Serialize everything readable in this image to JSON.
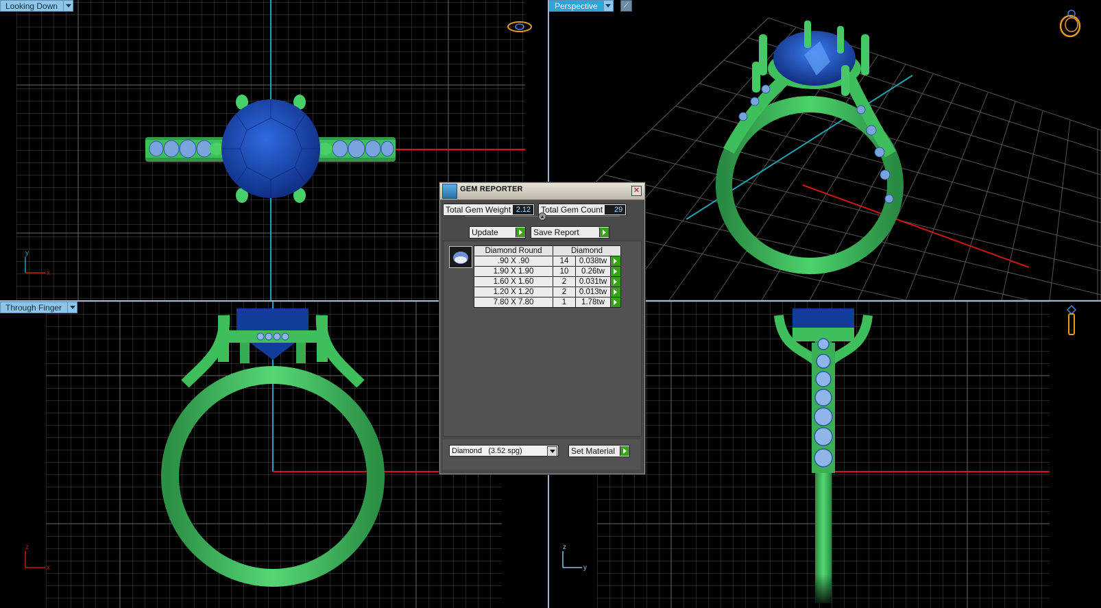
{
  "viewports": {
    "top_left": {
      "title": "Looking Down",
      "axes": [
        "y",
        "x"
      ]
    },
    "top_right": {
      "title": "Perspective"
    },
    "bottom_left": {
      "title": "Through Finger",
      "axes": [
        "z",
        "x"
      ]
    },
    "bottom_right": {
      "axes": [
        "z",
        "y"
      ]
    }
  },
  "dialog": {
    "title": "GEM REPORTER",
    "total_weight_label": "Total Gem Weight",
    "total_weight_value": "2.12",
    "total_count_label": "Total Gem Count",
    "total_count_value": "29",
    "update_label": "Update",
    "save_report_label": "Save Report",
    "table": {
      "headers": [
        "Diamond Round",
        "Diamond"
      ],
      "rows": [
        {
          "size": ".90 X .90",
          "count": "14",
          "weight": "0.038tw"
        },
        {
          "size": "1.90 X 1.90",
          "count": "10",
          "weight": "0.26tw"
        },
        {
          "size": "1.60 X 1.60",
          "count": "2",
          "weight": "0.031tw"
        },
        {
          "size": "1.20 X 1.20",
          "count": "2",
          "weight": "0.013tw"
        },
        {
          "size": "7.80 X 7.80",
          "count": "1",
          "weight": "1.78tw"
        }
      ]
    },
    "material_select": "Diamond   (3.52 spg)",
    "set_material_label": "Set Material"
  },
  "colors": {
    "metal": "#3fbf5c",
    "gem": "#1f4fb8",
    "grid": "#4d4d4d",
    "axis_red": "#d41414",
    "axis_cyan": "#1fa4b8",
    "viewport_label": "#8fc6e8",
    "go_button": "#3aa11a"
  },
  "icons": [
    "ring-top-icon",
    "ring-perspective-icon",
    "ring-side-icon",
    "close-icon",
    "gem-thumb-icon",
    "dropdown-arrow-icon",
    "play-arrow-icon"
  ]
}
